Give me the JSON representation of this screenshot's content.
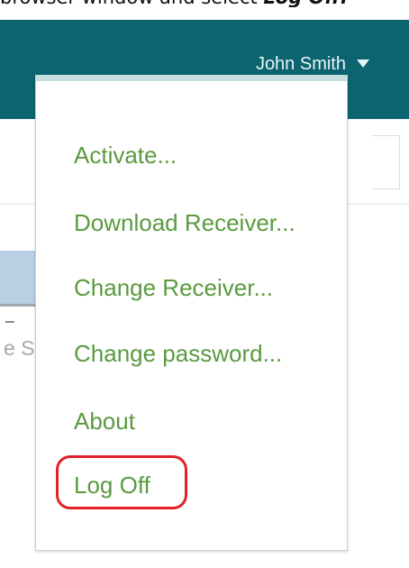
{
  "caption": {
    "prefix": "browser window and select",
    "emphasis": "Log Off."
  },
  "header": {
    "user_name": "John Smith",
    "menu_icon": "chevron-down-icon",
    "color": "#0b6470"
  },
  "menu": {
    "items": [
      {
        "label": "Activate..."
      },
      {
        "label": "Download Receiver..."
      },
      {
        "label": "Change Receiver..."
      },
      {
        "label": "Change password..."
      },
      {
        "label": "About"
      },
      {
        "label": "Log Off"
      }
    ],
    "text_color": "#5b9a3f",
    "highlight_color": "#e3202a"
  },
  "background": {
    "partial_text": "e S"
  }
}
